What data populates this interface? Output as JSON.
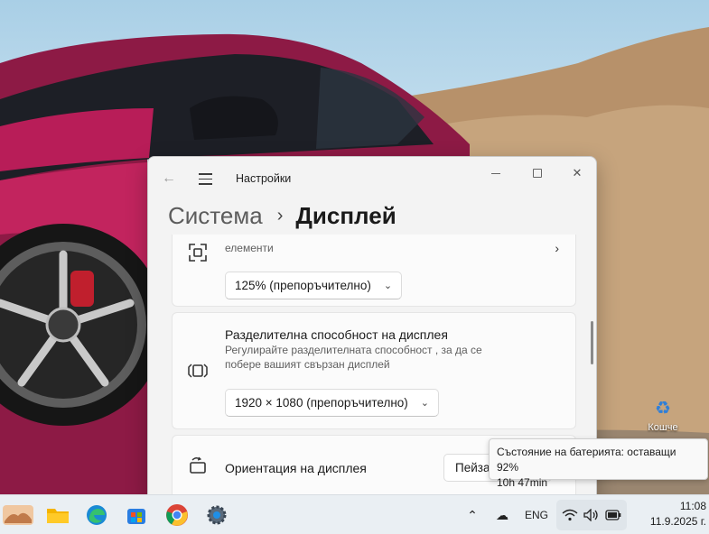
{
  "window": {
    "app_title": "Настройки",
    "breadcrumb_parent": "Система",
    "breadcrumb_separator": "›",
    "breadcrumb_current": "Дисплей"
  },
  "scale_card": {
    "partial_title": "елементи",
    "value": "125% (препоръчително)"
  },
  "resolution_card": {
    "title": "Разделителна способност на дисплея",
    "subtitle": "Регулирайте разделителната способност , за да се побере вашият свързан дисплей",
    "value": "1920 × 1080 (препоръчително)"
  },
  "orientation_card": {
    "title": "Ориентация на дисплея",
    "value": "Пейза"
  },
  "desktop": {
    "recycle_label": "Кошче"
  },
  "tooltip": {
    "line1": "Състояние на батерията: оставащи 92%",
    "line2": "10h 47min"
  },
  "taskbar": {
    "apps": [
      "widgets-icon",
      "file-explorer-icon",
      "edge-icon",
      "store-icon",
      "chrome-icon",
      "settings-icon"
    ],
    "language": "ENG",
    "time": "11:08",
    "date": "11.9.2025 г."
  },
  "colors": {
    "accent": "#0067c0",
    "car_body": "#a0154e",
    "taskbar_bg": "#eaeff3"
  }
}
